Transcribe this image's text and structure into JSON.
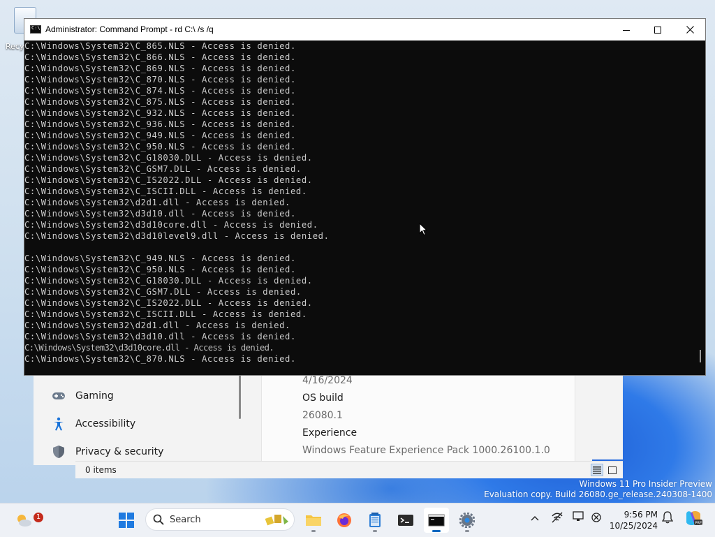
{
  "desktop": {
    "recycle_bin_label": "Recy",
    "watermark_line1": "Windows 11 Pro Insider Preview",
    "watermark_line2": "Evaluation copy. Build 26080.ge_release.240308-1400"
  },
  "cmd": {
    "title": "Administrator: Command Prompt - rd  C:\\ /s /q",
    "lines": [
      "C:\\Windows\\System32\\C_865.NLS - Access is denied.",
      "C:\\Windows\\System32\\C_866.NLS - Access is denied.",
      "C:\\Windows\\System32\\C_869.NLS - Access is denied.",
      "C:\\Windows\\System32\\C_870.NLS - Access is denied.",
      "C:\\Windows\\System32\\C_874.NLS - Access is denied.",
      "C:\\Windows\\System32\\C_875.NLS - Access is denied.",
      "C:\\Windows\\System32\\C_932.NLS - Access is denied.",
      "C:\\Windows\\System32\\C_936.NLS - Access is denied.",
      "C:\\Windows\\System32\\C_949.NLS - Access is denied.",
      "C:\\Windows\\System32\\C_950.NLS - Access is denied.",
      "C:\\Windows\\System32\\C_G18030.DLL - Access is denied.",
      "C:\\Windows\\System32\\C_GSM7.DLL - Access is denied.",
      "C:\\Windows\\System32\\C_IS2022.DLL - Access is denied.",
      "C:\\Windows\\System32\\C_ISCII.DLL - Access is denied.",
      "C:\\Windows\\System32\\d2d1.dll - Access is denied.",
      "C:\\Windows\\System32\\d3d10.dll - Access is denied.",
      "C:\\Windows\\System32\\d3d10core.dll - Access is denied.",
      "C:\\Windows\\System32\\d3d10level9.dll - Access is denied.",
      "",
      "C:\\Windows\\System32\\C_949.NLS - Access is denied.",
      "C:\\Windows\\System32\\C_950.NLS - Access is denied.",
      "C:\\Windows\\System32\\C_G18030.DLL - Access is denied.",
      "C:\\Windows\\System32\\C_GSM7.DLL - Access is denied.",
      "C:\\Windows\\System32\\C_IS2022.DLL - Access is denied.",
      "C:\\Windows\\System32\\C_ISCII.DLL - Access is denied.",
      "C:\\Windows\\System32\\d2d1.dll - Access is denied.",
      "C:\\Windows\\System32\\d3d10.dll - Access is denied.",
      "C:\\Windows\\System32\\d3d10core.dll - Access is denied.",
      "C:\\Windows\\System32\\C_870.NLS - Access is denied."
    ],
    "garbled_index": 27
  },
  "settings": {
    "nav": [
      {
        "label": "Gaming",
        "icon": "gamepad-icon"
      },
      {
        "label": "Accessibility",
        "icon": "accessibility-icon"
      },
      {
        "label": "Privacy & security",
        "icon": "shield-icon"
      }
    ],
    "info": {
      "date_value": "4/16/2024",
      "os_build_label": "OS build",
      "os_build_value": "26080.1",
      "experience_label": "Experience",
      "experience_value": "Windows Feature Experience Pack 1000.26100.1.0"
    }
  },
  "explorer": {
    "status_count": "0 items"
  },
  "taskbar": {
    "weather_badge": "1",
    "search_label": "Search",
    "time": "9:56 PM",
    "date": "10/25/2024",
    "colors": {
      "accent": "#0067c0",
      "badge": "#c42b1c"
    }
  }
}
